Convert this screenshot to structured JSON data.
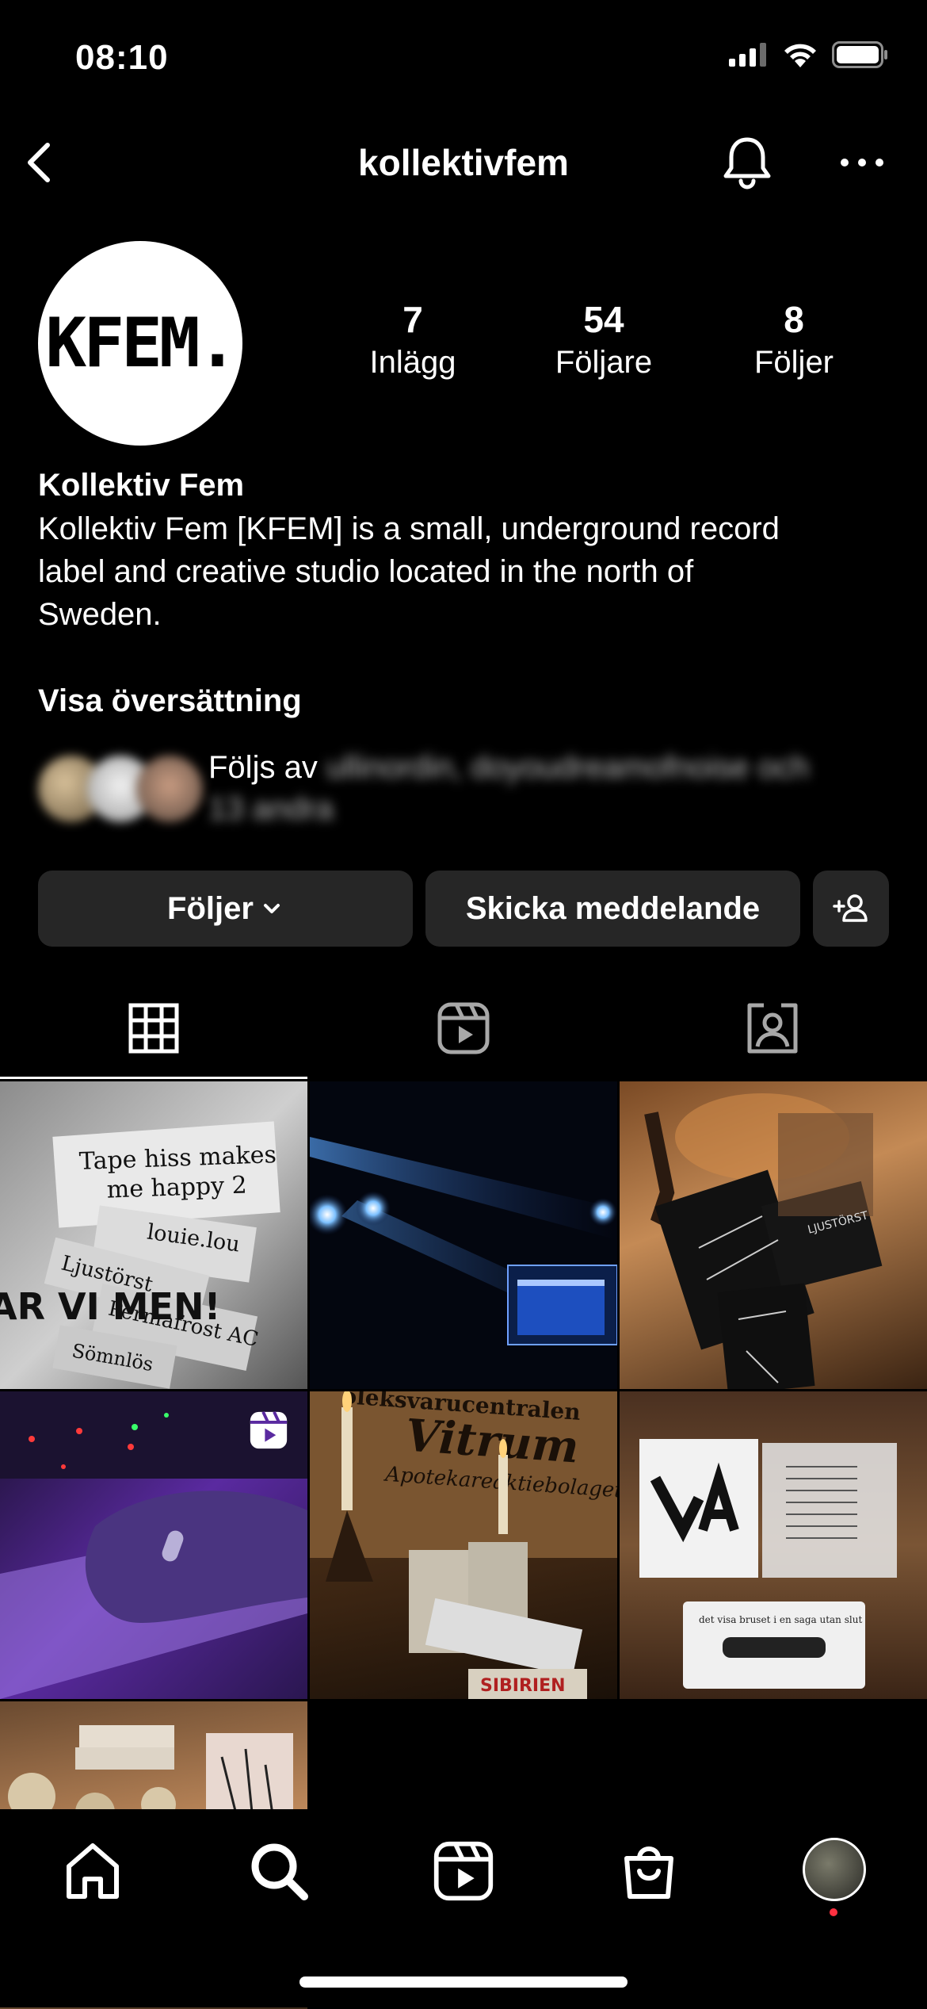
{
  "status_bar": {
    "time": "08:10"
  },
  "header": {
    "username": "kollektivfem"
  },
  "profile": {
    "avatar_text": "KFEM.",
    "stats": [
      {
        "value": "7",
        "label": "Inlägg"
      },
      {
        "value": "54",
        "label": "Följare"
      },
      {
        "value": "8",
        "label": "Följer"
      }
    ],
    "display_name": "Kollektiv Fem",
    "bio_lines": [
      "Kollektiv Fem [KFEM] is a small, underground record",
      "label and creative studio located in the north of",
      "Sweden."
    ],
    "translate_link": "Visa översättning",
    "followed_by_prefix": "Följs av",
    "followed_by_names": "ullinordin, doyoudreamofnoise",
    "followed_by_conj": "och",
    "followed_by_others": "13 andra"
  },
  "actions": {
    "following_label": "Följer",
    "message_label": "Skicka meddelande"
  },
  "tabs": [
    "grid-icon",
    "reels-icon",
    "tagged-icon"
  ],
  "grid": {
    "tile1_lines": [
      "Tape hiss makes",
      "me happy 2",
      "louie.lou",
      "Ljustörst",
      "Permafrost AC",
      "Sömnlös"
    ],
    "tile1_side": "AR VI MEN!",
    "tile5_sign": "Vitrum",
    "tile5_sub": "Apotekareaktiebolaget",
    "tile5_top": "oleksvarucentralen",
    "tile5_label": "SIBIRIEN",
    "tile6_logo": "VA",
    "tile6_caption": "det visa bruset i en saga utan slut",
    "tile3_label": "LJUSTÖRST"
  },
  "colors": {
    "background": "#000000",
    "button": "#262626",
    "accent_dot": "#ff3040"
  }
}
